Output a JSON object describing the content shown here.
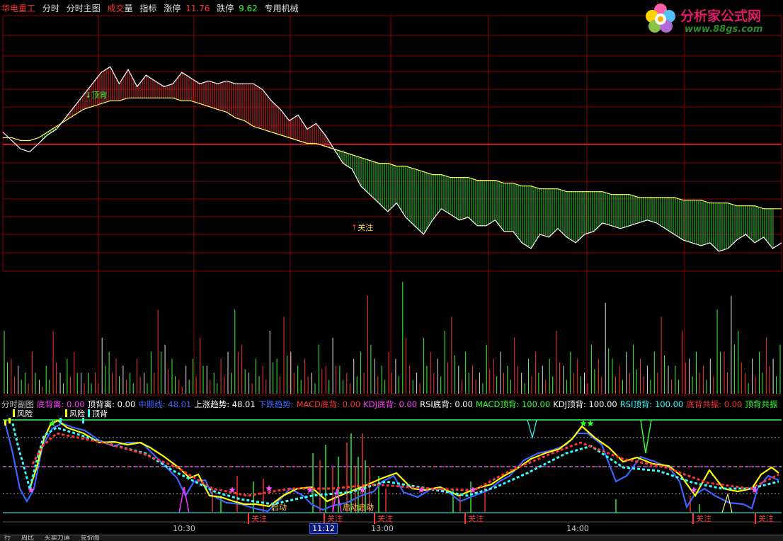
{
  "header": {
    "stock_name": "华电重工",
    "items": [
      "分时",
      "分时主图"
    ],
    "vol_a": "成交",
    "vol_b": "量",
    "indicator": "指标",
    "limit_up_label": "涨停",
    "limit_up_value": "11.76",
    "limit_down_label": "跌停",
    "limit_down_value": "9.62",
    "sector": "专用机械"
  },
  "logo": {
    "title": "分析家公式网",
    "url": "www.88gs.com"
  },
  "main_annotations": {
    "top_divergence": "顶背",
    "watch": "关注"
  },
  "sub_header": [
    {
      "text": "分时副图",
      "color": "#c0c0c0"
    },
    {
      "text": "底背离: 0.00",
      "color": "#ff3dff"
    },
    {
      "text": "顶背离: 0.00",
      "color": "#ffffff"
    },
    {
      "text": "中期线: 48.01",
      "color": "#3c64ff"
    },
    {
      "text": "上涨趋势: 48.01",
      "color": "#ffffff"
    },
    {
      "text": "下跌趋势:",
      "color": "#3c64ff"
    },
    {
      "text": "MACD底背: 0.00",
      "color": "#ff3333"
    },
    {
      "text": "KDJ底背: 0.00",
      "color": "#ff3dff"
    },
    {
      "text": "RSI底背: 0.00",
      "color": "#ffffff"
    },
    {
      "text": "MACD顶背: 100.00",
      "color": "#33ff33"
    },
    {
      "text": "KDJ顶背: 100.00",
      "color": "#ffffff"
    },
    {
      "text": "RSI顶背: 100.00",
      "color": "#33ffff"
    },
    {
      "text": "底背共振: 0.00",
      "color": "#ff3333"
    },
    {
      "text": "顶背共振",
      "color": "#33ff33"
    }
  ],
  "sub_legend": [
    "风险",
    "风险",
    "顶背"
  ],
  "sub_annotations": {
    "start": "启动",
    "start_group": "启动启动",
    "watch": "关注"
  },
  "time_axis": [
    "10:30",
    "11:12",
    "13:00",
    "14:00"
  ],
  "bottom_tabs": [
    "行",
    "周比",
    "买卖力道",
    "竞价图"
  ],
  "colors": {
    "grid": "#8c0000",
    "price": "#ffffff",
    "avg": "#ffff66",
    "up": "#ff3333",
    "down": "#33ff33",
    "mid": "#3c64ff",
    "fast": "#ffff00",
    "cyan": "#33ffff"
  },
  "chart_data": [
    {
      "type": "line",
      "title": "",
      "series": [
        {
          "name": "price",
          "values": [
            10.69,
            10.66,
            10.63,
            10.62,
            10.65,
            10.68,
            10.7,
            10.74,
            10.78,
            10.82,
            10.86,
            10.9,
            10.92,
            10.86,
            10.91,
            10.85,
            10.89,
            10.87,
            10.85,
            10.86,
            10.9,
            10.88,
            10.86,
            10.87,
            10.86,
            10.87,
            10.86,
            10.86,
            10.86,
            10.84,
            10.8,
            10.77,
            10.73,
            10.75,
            10.7,
            10.72,
            10.68,
            10.63,
            10.58,
            10.56,
            10.5,
            10.47,
            10.44,
            10.41,
            10.44,
            10.39,
            10.36,
            10.33,
            10.38,
            10.42,
            10.4,
            10.38,
            10.39,
            10.36,
            10.36,
            10.38,
            10.34,
            10.34,
            10.3,
            10.28,
            10.33,
            10.32,
            10.35,
            10.32,
            10.3,
            10.33,
            10.34,
            10.37,
            10.36,
            10.35,
            10.36,
            10.37,
            10.38,
            10.37,
            10.35,
            10.33,
            10.31,
            10.3,
            10.29,
            10.3,
            10.27,
            10.28,
            10.31,
            10.33,
            10.3,
            10.32,
            10.28,
            10.3
          ]
        },
        {
          "name": "avg",
          "values": [
            10.67,
            10.67,
            10.66,
            10.66,
            10.67,
            10.69,
            10.71,
            10.73,
            10.75,
            10.77,
            10.78,
            10.79,
            10.8,
            10.8,
            10.81,
            10.81,
            10.81,
            10.81,
            10.81,
            10.81,
            10.8,
            10.8,
            10.79,
            10.78,
            10.77,
            10.76,
            10.74,
            10.73,
            10.71,
            10.7,
            10.69,
            10.68,
            10.67,
            10.66,
            10.65,
            10.65,
            10.64,
            10.63,
            10.62,
            10.61,
            10.6,
            10.59,
            10.58,
            10.58,
            10.57,
            10.57,
            10.56,
            10.55,
            10.54,
            10.54,
            10.53,
            10.53,
            10.53,
            10.52,
            10.52,
            10.52,
            10.51,
            10.51,
            10.5,
            10.5,
            10.49,
            10.49,
            10.49,
            10.48,
            10.48,
            10.48,
            10.48,
            10.48,
            10.47,
            10.47,
            10.47,
            10.46,
            10.46,
            10.46,
            10.46,
            10.46,
            10.45,
            10.45,
            10.45,
            10.44,
            10.44,
            10.44,
            10.43,
            10.43,
            10.43,
            10.42,
            10.42,
            10.42
          ]
        }
      ]
    },
    {
      "type": "bar",
      "title": "",
      "values": [
        9,
        5,
        4,
        3,
        6,
        2,
        4,
        9,
        3,
        5,
        6,
        3,
        3,
        3,
        8,
        6,
        5,
        4,
        3,
        5,
        3,
        6,
        12,
        7,
        5,
        2,
        4,
        5,
        8,
        4,
        3,
        5,
        6,
        12,
        7,
        3,
        5,
        4,
        9,
        5,
        11,
        6,
        4,
        5,
        3,
        7,
        4,
        8,
        4,
        3,
        5,
        6,
        14,
        5,
        4,
        6,
        5,
        16,
        4,
        3,
        8,
        6,
        5,
        9,
        11,
        4,
        6,
        4,
        3,
        7,
        5,
        6,
        4,
        8,
        3,
        5,
        6,
        4,
        5,
        9,
        4,
        6,
        5,
        3,
        7,
        5,
        13,
        5,
        4,
        6,
        7,
        5,
        4,
        6,
        11,
        4,
        4,
        9,
        5,
        6,
        4,
        5,
        12,
        6,
        14,
        9,
        3,
        5,
        6,
        8,
        5,
        7
      ]
    }
  ]
}
